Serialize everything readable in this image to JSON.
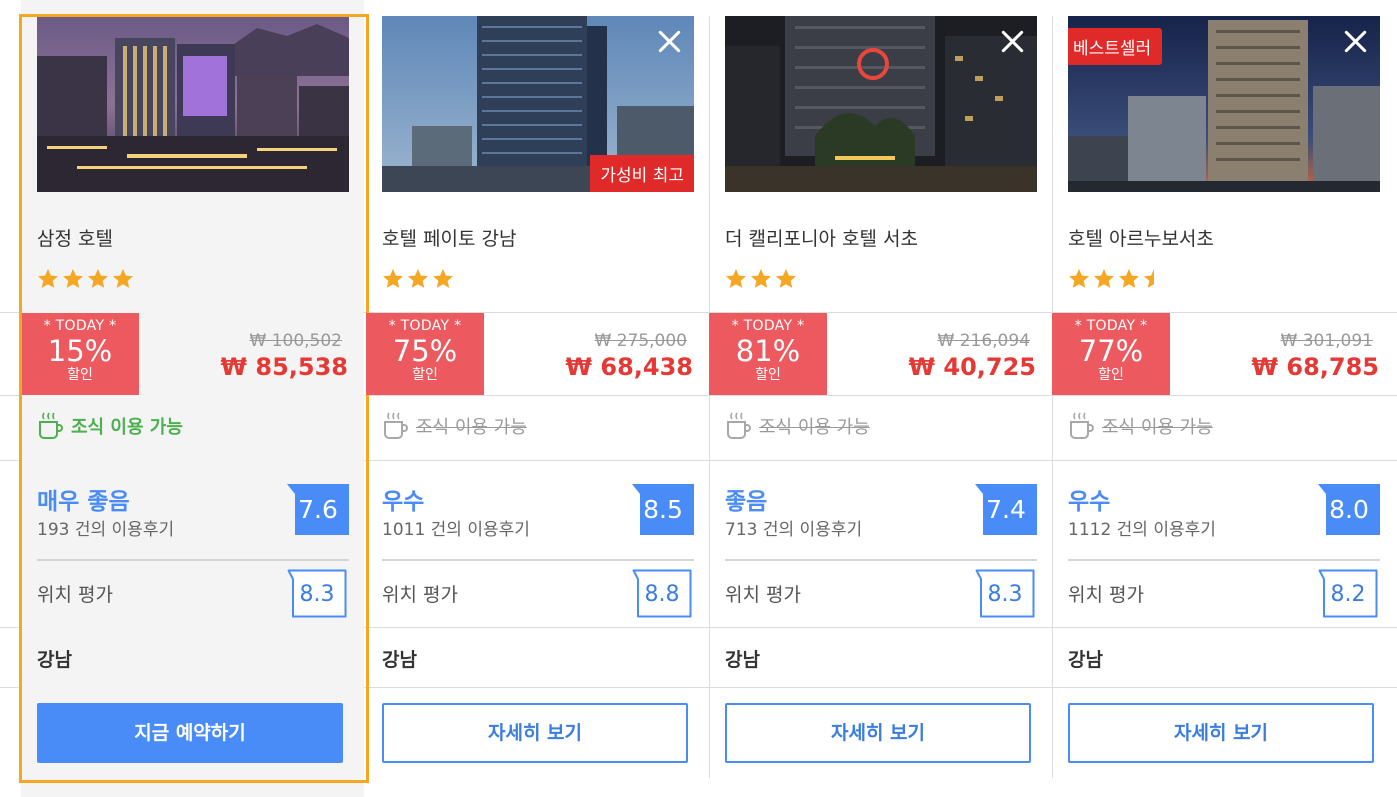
{
  "hotels": [
    {
      "name": "삼정 호텔",
      "stars": 4,
      "photo_badge": "",
      "closable": false,
      "today_label": "* TODAY *",
      "discount": "15%",
      "discount_suffix": "할인",
      "original_price": "₩ 100,502",
      "sale_price": "₩ 85,538",
      "breakfast": "조식 이용 가능",
      "breakfast_available": true,
      "rating_word": "매우 좋음",
      "reviews": "193 건의 이용후기",
      "score": "7.6",
      "location_label": "위치 평가",
      "location_score": "8.3",
      "district": "강남",
      "button": "지금 예약하기"
    },
    {
      "name": "호텔 페이토 강남",
      "stars": 3,
      "photo_badge": "가성비 최고",
      "closable": true,
      "today_label": "* TODAY *",
      "discount": "75%",
      "discount_suffix": "할인",
      "original_price": "₩ 275,000",
      "sale_price": "₩ 68,438",
      "breakfast": "조식 이용 가능",
      "breakfast_available": false,
      "rating_word": "우수",
      "reviews": "1011 건의 이용후기",
      "score": "8.5",
      "location_label": "위치 평가",
      "location_score": "8.8",
      "district": "강남",
      "button": "자세히 보기"
    },
    {
      "name": "더 캘리포니아 호텔 서초",
      "stars": 3,
      "photo_badge": "",
      "closable": true,
      "today_label": "* TODAY *",
      "discount": "81%",
      "discount_suffix": "할인",
      "original_price": "₩ 216,094",
      "sale_price": "₩ 40,725",
      "breakfast": "조식 이용 가능",
      "breakfast_available": false,
      "rating_word": "좋음",
      "reviews": "713 건의 이용후기",
      "score": "7.4",
      "location_label": "위치 평가",
      "location_score": "8.3",
      "district": "강남",
      "button": "자세히 보기"
    },
    {
      "name": "호텔 아르누보서초",
      "stars": 3.5,
      "photo_badge": "베스트셀러",
      "closable": true,
      "today_label": "* TODAY *",
      "discount": "77%",
      "discount_suffix": "할인",
      "original_price": "₩ 301,091",
      "sale_price": "₩ 68,785",
      "breakfast": "조식 이용 가능",
      "breakfast_available": false,
      "rating_word": "우수",
      "reviews": "1112 건의 이용후기",
      "score": "8.0",
      "location_label": "위치 평가",
      "location_score": "8.2",
      "district": "강남",
      "button": "자세히 보기"
    }
  ],
  "colors": {
    "accent": "#4a8cf7",
    "sale_red": "#e53935",
    "deal_badge": "#ec5a5f",
    "star": "#f5a623",
    "selected_border": "#f5a623",
    "breakfast_green": "#4caf50"
  }
}
